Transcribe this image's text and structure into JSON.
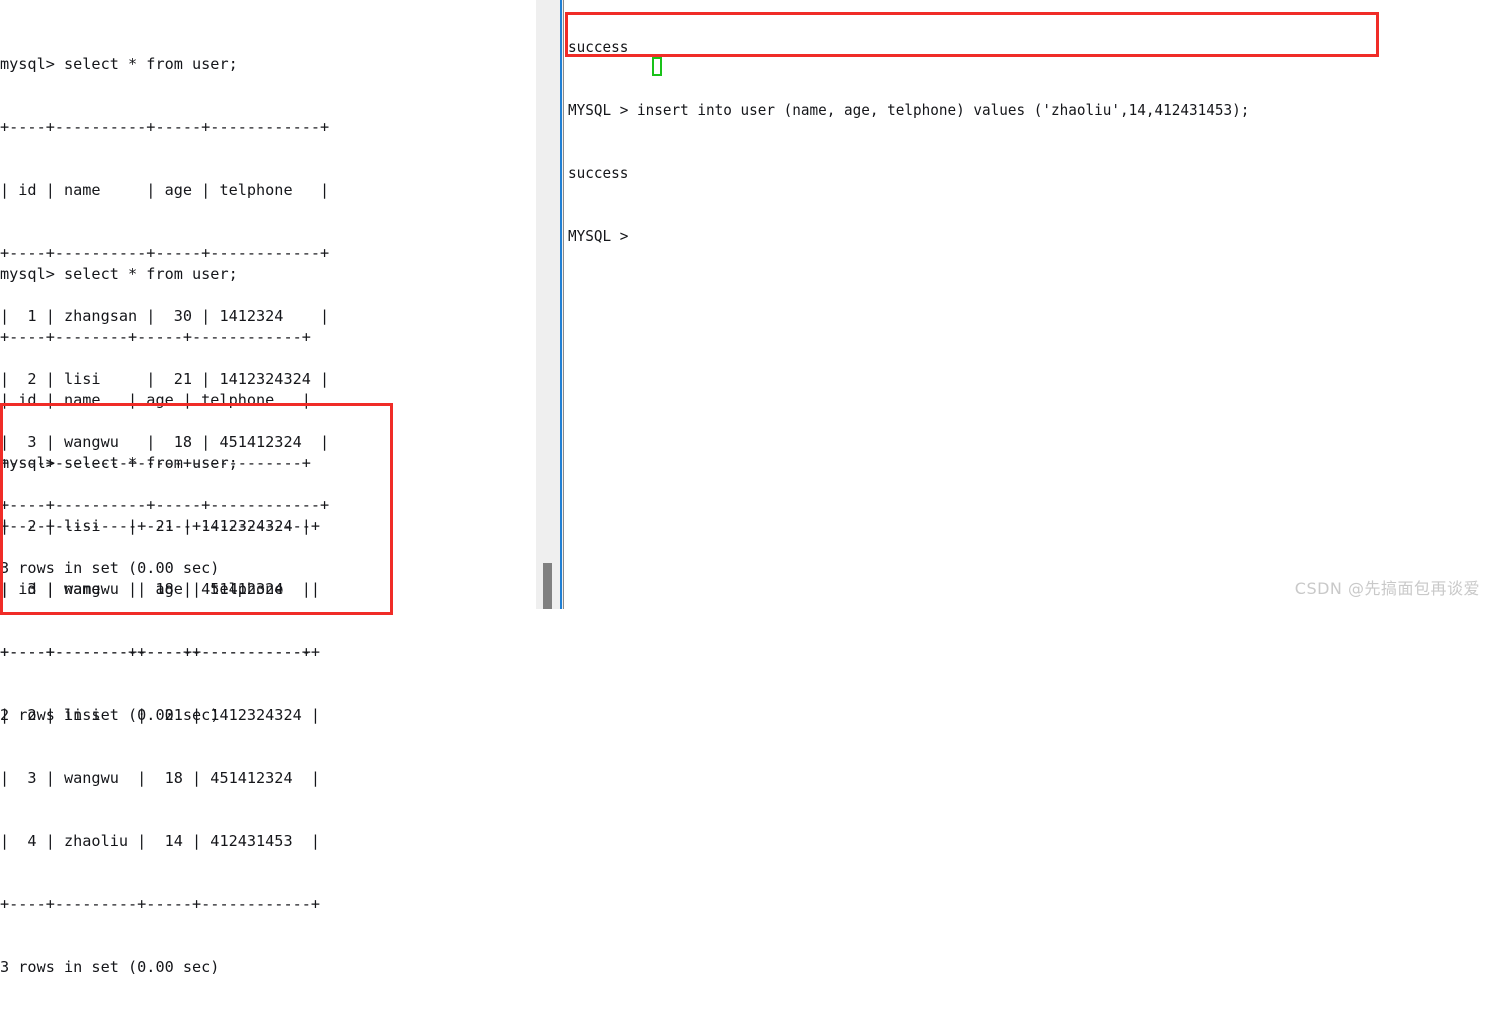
{
  "left_terminal": {
    "blocks": [
      {
        "prompt_line": "mysql> select * from user;",
        "lines": [
          "mysql> select * from user;",
          "+----+----------+-----+------------+",
          "| id | name     | age | telphone   |",
          "+----+----------+-----+------------+",
          "|  1 | zhangsan |  30 | 1412324    |",
          "|  2 | lisi     |  21 | 1412324324 |",
          "|  3 | wangwu   |  18 | 451412324  |",
          "+----+----------+-----+------------+",
          "3 rows in set (0.00 sec)"
        ],
        "result_summary": "3 rows in set (0.00 sec)",
        "table": {
          "columns": [
            "id",
            "name",
            "age",
            "telphone"
          ],
          "rows": [
            [
              "1",
              "zhangsan",
              "30",
              "1412324"
            ],
            [
              "2",
              "lisi",
              "21",
              "1412324324"
            ],
            [
              "3",
              "wangwu",
              "18",
              "451412324"
            ]
          ]
        }
      },
      {
        "prompt_line": "mysql> select * from user;",
        "lines": [
          "mysql> select * from user;",
          "+----+--------+-----+------------+",
          "| id | name   | age | telphone   |",
          "+----+--------+-----+------------+",
          "|  2 | lisi   |  21 | 1412324324 |",
          "|  3 | wangwu |  18 | 451412324  |",
          "+----+--------+-----+------------+",
          "2 rows in set (0.00 sec)"
        ],
        "result_summary": "2 rows in set (0.00 sec)",
        "table": {
          "columns": [
            "id",
            "name",
            "age",
            "telphone"
          ],
          "rows": [
            [
              "2",
              "lisi",
              "21",
              "1412324324"
            ],
            [
              "3",
              "wangwu",
              "18",
              "451412324"
            ]
          ]
        }
      },
      {
        "prompt_line": "mysql> select * from user;",
        "lines": [
          "mysql> select * from user;",
          "+----+---------+-----+------------+",
          "| id | name    | age | telphone   |",
          "+----+---------+-----+------------+",
          "|  2 | lisi    |  21 | 1412324324 |",
          "|  3 | wangwu  |  18 | 451412324  |",
          "|  4 | zhaoliu |  14 | 412431453  |",
          "+----+---------+-----+------------+",
          "3 rows in set (0.00 sec)"
        ],
        "result_summary": "3 rows in set (0.00 sec)",
        "table": {
          "columns": [
            "id",
            "name",
            "age",
            "telphone"
          ],
          "rows": [
            [
              "2",
              "lisi",
              "21",
              "1412324324"
            ],
            [
              "3",
              "wangwu",
              "18",
              "451412324"
            ],
            [
              "4",
              "zhaoliu",
              "14",
              "412431453"
            ]
          ]
        }
      }
    ]
  },
  "right_console": {
    "lines": [
      "success",
      "MYSQL > insert into user (name, age, telphone) values ('zhaoliu',14,412431453);",
      "success",
      "MYSQL > "
    ],
    "prompt": "MYSQL > ",
    "command": "insert into user (name, age, telphone) values ('zhaoliu',14,412431453);",
    "status_before": "success",
    "status_after": "success",
    "cursor_visible": true
  },
  "annotations": {
    "left_highlight_color": "#f02c27",
    "right_highlight_color": "#f02c27",
    "cursor_color": "#19c219"
  },
  "scrollbar": {
    "orientation": "vertical",
    "thumb_position": "bottom"
  },
  "watermark": {
    "text": "CSDN @先搞面包再谈爱"
  }
}
